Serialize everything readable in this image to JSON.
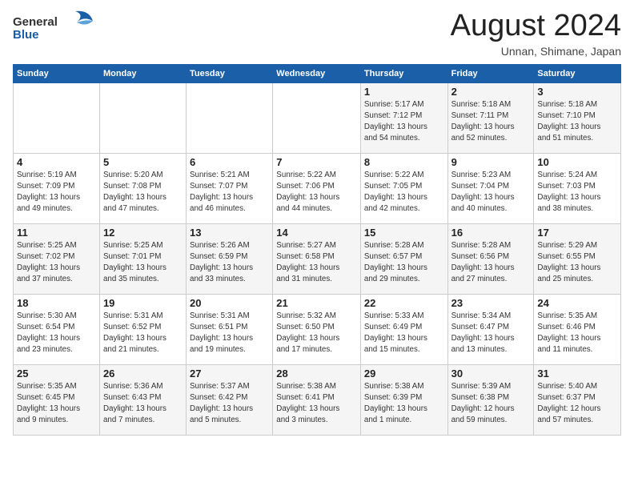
{
  "header": {
    "logo_line1": "General",
    "logo_line2": "Blue",
    "month": "August 2024",
    "location": "Unnan, Shimane, Japan"
  },
  "weekdays": [
    "Sunday",
    "Monday",
    "Tuesday",
    "Wednesday",
    "Thursday",
    "Friday",
    "Saturday"
  ],
  "weeks": [
    [
      {
        "day": "",
        "info": ""
      },
      {
        "day": "",
        "info": ""
      },
      {
        "day": "",
        "info": ""
      },
      {
        "day": "",
        "info": ""
      },
      {
        "day": "1",
        "info": "Sunrise: 5:17 AM\nSunset: 7:12 PM\nDaylight: 13 hours\nand 54 minutes."
      },
      {
        "day": "2",
        "info": "Sunrise: 5:18 AM\nSunset: 7:11 PM\nDaylight: 13 hours\nand 52 minutes."
      },
      {
        "day": "3",
        "info": "Sunrise: 5:18 AM\nSunset: 7:10 PM\nDaylight: 13 hours\nand 51 minutes."
      }
    ],
    [
      {
        "day": "4",
        "info": "Sunrise: 5:19 AM\nSunset: 7:09 PM\nDaylight: 13 hours\nand 49 minutes."
      },
      {
        "day": "5",
        "info": "Sunrise: 5:20 AM\nSunset: 7:08 PM\nDaylight: 13 hours\nand 47 minutes."
      },
      {
        "day": "6",
        "info": "Sunrise: 5:21 AM\nSunset: 7:07 PM\nDaylight: 13 hours\nand 46 minutes."
      },
      {
        "day": "7",
        "info": "Sunrise: 5:22 AM\nSunset: 7:06 PM\nDaylight: 13 hours\nand 44 minutes."
      },
      {
        "day": "8",
        "info": "Sunrise: 5:22 AM\nSunset: 7:05 PM\nDaylight: 13 hours\nand 42 minutes."
      },
      {
        "day": "9",
        "info": "Sunrise: 5:23 AM\nSunset: 7:04 PM\nDaylight: 13 hours\nand 40 minutes."
      },
      {
        "day": "10",
        "info": "Sunrise: 5:24 AM\nSunset: 7:03 PM\nDaylight: 13 hours\nand 38 minutes."
      }
    ],
    [
      {
        "day": "11",
        "info": "Sunrise: 5:25 AM\nSunset: 7:02 PM\nDaylight: 13 hours\nand 37 minutes."
      },
      {
        "day": "12",
        "info": "Sunrise: 5:25 AM\nSunset: 7:01 PM\nDaylight: 13 hours\nand 35 minutes."
      },
      {
        "day": "13",
        "info": "Sunrise: 5:26 AM\nSunset: 6:59 PM\nDaylight: 13 hours\nand 33 minutes."
      },
      {
        "day": "14",
        "info": "Sunrise: 5:27 AM\nSunset: 6:58 PM\nDaylight: 13 hours\nand 31 minutes."
      },
      {
        "day": "15",
        "info": "Sunrise: 5:28 AM\nSunset: 6:57 PM\nDaylight: 13 hours\nand 29 minutes."
      },
      {
        "day": "16",
        "info": "Sunrise: 5:28 AM\nSunset: 6:56 PM\nDaylight: 13 hours\nand 27 minutes."
      },
      {
        "day": "17",
        "info": "Sunrise: 5:29 AM\nSunset: 6:55 PM\nDaylight: 13 hours\nand 25 minutes."
      }
    ],
    [
      {
        "day": "18",
        "info": "Sunrise: 5:30 AM\nSunset: 6:54 PM\nDaylight: 13 hours\nand 23 minutes."
      },
      {
        "day": "19",
        "info": "Sunrise: 5:31 AM\nSunset: 6:52 PM\nDaylight: 13 hours\nand 21 minutes."
      },
      {
        "day": "20",
        "info": "Sunrise: 5:31 AM\nSunset: 6:51 PM\nDaylight: 13 hours\nand 19 minutes."
      },
      {
        "day": "21",
        "info": "Sunrise: 5:32 AM\nSunset: 6:50 PM\nDaylight: 13 hours\nand 17 minutes."
      },
      {
        "day": "22",
        "info": "Sunrise: 5:33 AM\nSunset: 6:49 PM\nDaylight: 13 hours\nand 15 minutes."
      },
      {
        "day": "23",
        "info": "Sunrise: 5:34 AM\nSunset: 6:47 PM\nDaylight: 13 hours\nand 13 minutes."
      },
      {
        "day": "24",
        "info": "Sunrise: 5:35 AM\nSunset: 6:46 PM\nDaylight: 13 hours\nand 11 minutes."
      }
    ],
    [
      {
        "day": "25",
        "info": "Sunrise: 5:35 AM\nSunset: 6:45 PM\nDaylight: 13 hours\nand 9 minutes."
      },
      {
        "day": "26",
        "info": "Sunrise: 5:36 AM\nSunset: 6:43 PM\nDaylight: 13 hours\nand 7 minutes."
      },
      {
        "day": "27",
        "info": "Sunrise: 5:37 AM\nSunset: 6:42 PM\nDaylight: 13 hours\nand 5 minutes."
      },
      {
        "day": "28",
        "info": "Sunrise: 5:38 AM\nSunset: 6:41 PM\nDaylight: 13 hours\nand 3 minutes."
      },
      {
        "day": "29",
        "info": "Sunrise: 5:38 AM\nSunset: 6:39 PM\nDaylight: 13 hours\nand 1 minute."
      },
      {
        "day": "30",
        "info": "Sunrise: 5:39 AM\nSunset: 6:38 PM\nDaylight: 12 hours\nand 59 minutes."
      },
      {
        "day": "31",
        "info": "Sunrise: 5:40 AM\nSunset: 6:37 PM\nDaylight: 12 hours\nand 57 minutes."
      }
    ]
  ]
}
